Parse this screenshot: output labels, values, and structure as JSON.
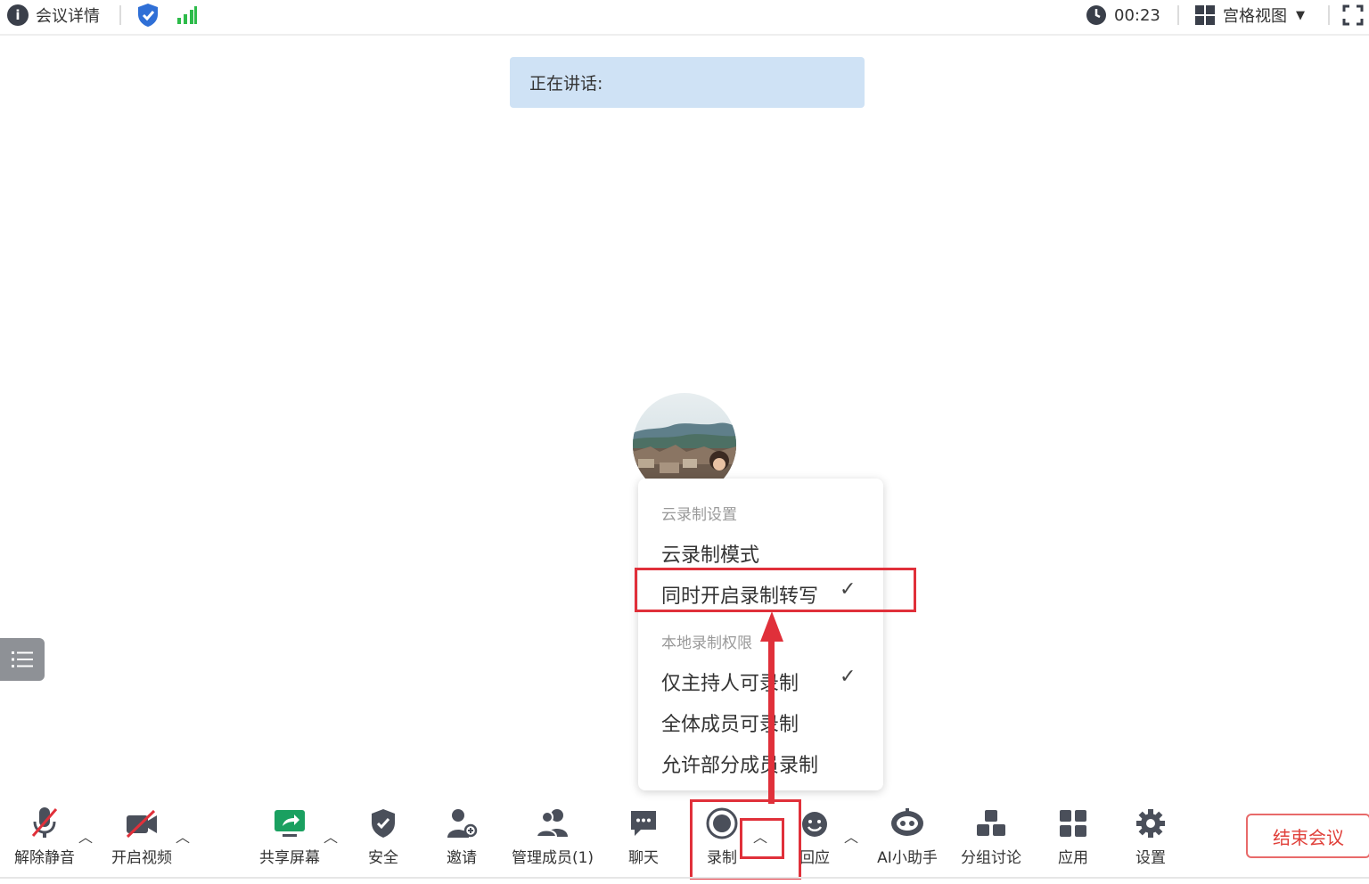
{
  "topbar": {
    "meeting_info": "会议详情",
    "timer": "00:23",
    "view_mode": "宫格视图"
  },
  "speaking": {
    "label": "正在讲话:"
  },
  "record_menu": {
    "cloud_section": "云录制设置",
    "cloud_mode": "云录制模式",
    "transcribe": "同时开启录制转写",
    "transcribe_checked": true,
    "local_section": "本地录制权限",
    "host_only": "仅主持人可录制",
    "host_only_checked": true,
    "all_members": "全体成员可录制",
    "some_members": "允许部分成员录制"
  },
  "toolbar": {
    "unmute": "解除静音",
    "start_video": "开启视频",
    "share_screen": "共享屏幕",
    "security": "安全",
    "invite": "邀请",
    "manage_members": "管理成员(1)",
    "chat": "聊天",
    "record": "录制",
    "react": "回应",
    "ai_assistant": "AI小助手",
    "breakout": "分组讨论",
    "apps": "应用",
    "settings": "设置",
    "end_meeting": "结束会议"
  },
  "colors": {
    "highlight": "#e0303a",
    "banner": "#cfe2f5",
    "shield": "#2f6fd6",
    "signal": "#2dbb4a",
    "share_green": "#1aa060"
  }
}
